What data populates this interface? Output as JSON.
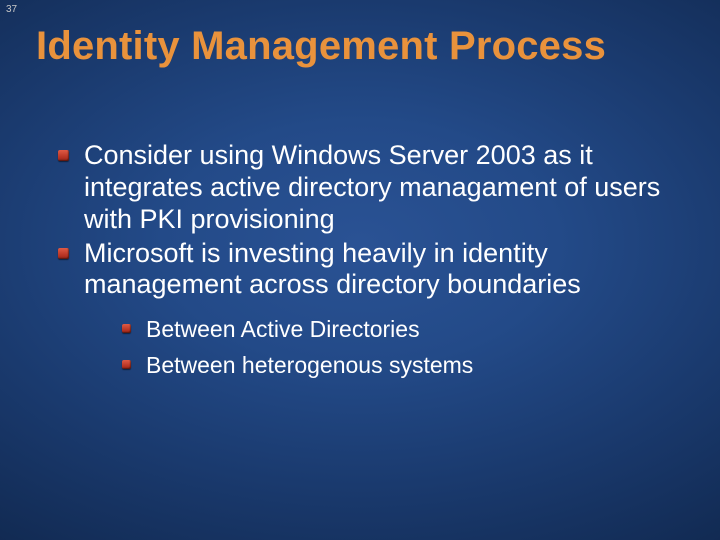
{
  "page_number": "37",
  "title": "Identity Management Process",
  "bullets": {
    "b1": "Consider using Windows Server 2003 as it integrates active directory managament of users with PKI provisioning",
    "b2": "Microsoft is investing heavily in identity management across directory boundaries",
    "b2_sub1": "Between Active Directories",
    "b2_sub2": "Between heterogenous systems"
  }
}
